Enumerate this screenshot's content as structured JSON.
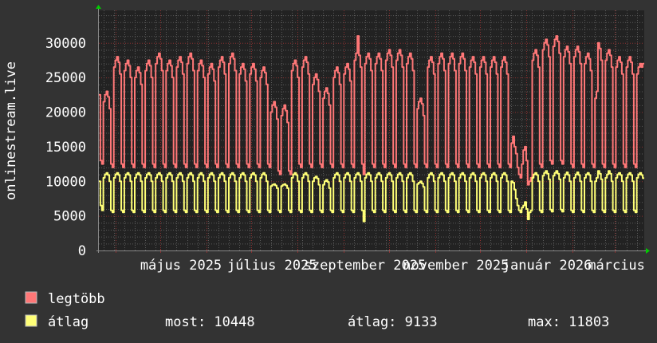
{
  "chart_data": {
    "type": "line",
    "ylabel": "onlinestream.live",
    "ylim": [
      0,
      34700
    ],
    "xlim": [
      "2025-03-21",
      "2026-03-21"
    ],
    "grid": true,
    "y_ticks": [
      "0",
      "5000",
      "10000",
      "15000",
      "20000",
      "25000",
      "30000"
    ],
    "y_tick_values": [
      0,
      5000,
      10000,
      15000,
      20000,
      25000,
      30000
    ],
    "x_tick_labels": [
      {
        "label": "május 2025",
        "date": "2025-05-15"
      },
      {
        "label": "július 2025",
        "date": "2025-07-15"
      },
      {
        "label": "szeptember 2025",
        "date": "2025-09-15"
      },
      {
        "label": "november 2025",
        "date": "2025-11-15"
      },
      {
        "label": "január 2026",
        "date": "2026-01-15"
      },
      {
        "label": "március",
        "date": "2026-03-15"
      }
    ],
    "series": [
      {
        "name": "legtöbb",
        "color": "#ff7777",
        "values": [
          22500,
          13000,
          12500,
          21500,
          22500,
          23000,
          22200,
          20500,
          12500,
          12000,
          26500,
          27500,
          28000,
          27200,
          25500,
          12500,
          12000,
          26000,
          27000,
          27500,
          26700,
          25000,
          12500,
          12000,
          25000,
          26000,
          26500,
          25700,
          24000,
          12500,
          12000,
          26000,
          27000,
          27500,
          26700,
          25000,
          12500,
          12000,
          27000,
          28000,
          28500,
          27700,
          26000,
          12500,
          12000,
          26000,
          27000,
          27500,
          26700,
          25000,
          12500,
          12000,
          26500,
          27500,
          28000,
          27200,
          25500,
          12500,
          12000,
          27000,
          28000,
          28500,
          27700,
          26000,
          12500,
          12000,
          26000,
          27000,
          27500,
          26700,
          25000,
          12500,
          12000,
          25500,
          26500,
          27000,
          26200,
          24500,
          12500,
          12000,
          26500,
          27500,
          28000,
          27200,
          25500,
          12500,
          12000,
          27000,
          28000,
          28500,
          27700,
          26000,
          12500,
          12000,
          25500,
          26500,
          27000,
          26200,
          24500,
          12500,
          12000,
          25500,
          26500,
          27000,
          26200,
          24500,
          12500,
          12000,
          25000,
          26000,
          26500,
          25700,
          24000,
          12500,
          12000,
          20000,
          21000,
          21500,
          20700,
          19000,
          11500,
          11000,
          19500,
          20500,
          21000,
          20200,
          18500,
          11500,
          11000,
          26000,
          27000,
          27500,
          26700,
          25000,
          12500,
          12000,
          26500,
          27500,
          28000,
          27200,
          25500,
          12500,
          12000,
          24000,
          25000,
          25500,
          24700,
          23000,
          12500,
          12000,
          22000,
          23000,
          23500,
          22700,
          21000,
          12500,
          12000,
          25000,
          26000,
          26500,
          25700,
          24000,
          12500,
          12000,
          25500,
          26500,
          27000,
          26200,
          24500,
          12500,
          12000,
          27500,
          28500,
          31000,
          28200,
          26500,
          12500,
          11000,
          27000,
          28000,
          28500,
          27700,
          26000,
          12500,
          12000,
          27000,
          28000,
          28500,
          27700,
          26000,
          12500,
          12000,
          27500,
          28500,
          29000,
          28200,
          26500,
          12500,
          12000,
          27500,
          28500,
          29000,
          28200,
          26500,
          12500,
          12000,
          27000,
          28000,
          28500,
          27700,
          26000,
          12500,
          12000,
          20500,
          21500,
          22000,
          21200,
          19500,
          12500,
          12000,
          26500,
          27500,
          28000,
          27200,
          25500,
          12500,
          12000,
          27000,
          28000,
          28500,
          27700,
          26000,
          12500,
          12000,
          27000,
          28000,
          28500,
          27700,
          26000,
          12500,
          12000,
          27000,
          28000,
          28500,
          27700,
          26000,
          12500,
          12000,
          26500,
          27500,
          28000,
          27200,
          25500,
          12500,
          12000,
          26500,
          27500,
          28000,
          27200,
          25500,
          12500,
          12000,
          26500,
          27500,
          28000,
          27200,
          25500,
          12500,
          12000,
          26500,
          27500,
          28000,
          27200,
          25500,
          12500,
          12000,
          15500,
          16500,
          15000,
          14000,
          12000,
          11000,
          10500,
          12500,
          14500,
          15000,
          13000,
          9500,
          10000,
          10500,
          27500,
          28500,
          29000,
          28200,
          26500,
          12500,
          12000,
          29000,
          30000,
          30500,
          29700,
          28000,
          13000,
          12500,
          29500,
          30500,
          31000,
          30200,
          28500,
          13000,
          12500,
          28000,
          29000,
          29500,
          28700,
          27000,
          12500,
          12000,
          28000,
          29000,
          29500,
          28700,
          27000,
          12500,
          12000,
          27000,
          28000,
          28500,
          27700,
          26000,
          12500,
          12000,
          22000,
          23000,
          30000,
          29200,
          27500,
          12500,
          12000,
          27500,
          28500,
          29000,
          28200,
          26500,
          12500,
          12000,
          26500,
          27500,
          28000,
          27200,
          25500,
          12500,
          12000,
          26500,
          27500,
          28000,
          27200,
          25500,
          12500,
          12000,
          25500,
          26500,
          27000,
          26500,
          27000
        ]
      },
      {
        "name": "átlag",
        "color": "#ffff77",
        "values": [
          10000,
          6500,
          5800,
          10500,
          11000,
          11200,
          10900,
          10000,
          5800,
          5500,
          10500,
          11000,
          11200,
          10900,
          10000,
          5800,
          5500,
          10500,
          11000,
          11200,
          10900,
          10000,
          5800,
          5500,
          10500,
          11000,
          11200,
          10900,
          10000,
          5800,
          5500,
          10500,
          11000,
          11200,
          10900,
          10000,
          5800,
          5500,
          10500,
          11000,
          11200,
          10900,
          10000,
          5800,
          5500,
          10500,
          11000,
          11200,
          10900,
          10000,
          5800,
          5500,
          10500,
          11000,
          11200,
          10900,
          10000,
          5800,
          5500,
          10500,
          11000,
          11200,
          10900,
          10000,
          5800,
          5500,
          10500,
          11000,
          11200,
          10900,
          10000,
          5800,
          5500,
          10500,
          11000,
          11200,
          10900,
          10000,
          5800,
          5500,
          10500,
          11000,
          11200,
          10900,
          10000,
          5800,
          5500,
          10500,
          11000,
          11200,
          10900,
          10000,
          5800,
          5500,
          10500,
          11000,
          11200,
          10900,
          10000,
          5800,
          5500,
          10500,
          11000,
          11200,
          10900,
          10000,
          5800,
          5500,
          10500,
          11000,
          11200,
          10900,
          10000,
          5800,
          5500,
          9300,
          9500,
          9600,
          9400,
          9000,
          5800,
          5500,
          9300,
          9500,
          9600,
          9400,
          9000,
          5800,
          5500,
          10500,
          11000,
          11200,
          10900,
          10000,
          5800,
          5500,
          10500,
          11000,
          11200,
          10900,
          10000,
          5800,
          5500,
          10000,
          10500,
          10700,
          10400,
          9500,
          5800,
          5500,
          9500,
          10000,
          10200,
          9900,
          9000,
          5800,
          5500,
          10500,
          11000,
          11200,
          10900,
          10000,
          5800,
          5500,
          10500,
          11000,
          11200,
          10900,
          10000,
          5800,
          5500,
          10500,
          11000,
          11200,
          10900,
          10000,
          5800,
          4200,
          10500,
          11000,
          11200,
          10900,
          10000,
          5800,
          5500,
          10500,
          11000,
          11200,
          10900,
          10000,
          5800,
          5500,
          10500,
          11000,
          11200,
          10900,
          10000,
          5800,
          5500,
          10500,
          11000,
          11200,
          10900,
          10000,
          5800,
          5500,
          10500,
          11000,
          11200,
          10900,
          10000,
          5800,
          5500,
          9600,
          9800,
          10000,
          9700,
          9200,
          5800,
          5500,
          10500,
          11000,
          11200,
          10900,
          10000,
          5800,
          5500,
          10500,
          11000,
          11200,
          10900,
          10000,
          5800,
          5500,
          10500,
          11000,
          11200,
          10900,
          10000,
          5800,
          5500,
          10500,
          11000,
          11200,
          10900,
          10000,
          5800,
          5500,
          10500,
          11000,
          11200,
          10900,
          10000,
          5800,
          5500,
          10500,
          11000,
          11200,
          10900,
          10000,
          5800,
          5500,
          10500,
          11000,
          11200,
          10900,
          10000,
          5800,
          5500,
          10500,
          11000,
          11200,
          10900,
          10000,
          5800,
          5500,
          10000,
          9800,
          8800,
          7500,
          6500,
          5800,
          5500,
          6200,
          6500,
          7000,
          6000,
          4500,
          5500,
          5800,
          10500,
          11000,
          11200,
          10900,
          10000,
          5800,
          5500,
          10800,
          11200,
          11500,
          11100,
          10300,
          5900,
          5600,
          10800,
          11200,
          11500,
          11100,
          10300,
          5900,
          5600,
          10500,
          11000,
          11300,
          10900,
          10000,
          5800,
          5500,
          10500,
          11000,
          11300,
          10900,
          10000,
          5800,
          5500,
          10500,
          11000,
          11200,
          10900,
          10000,
          5800,
          5500,
          10000,
          10500,
          11500,
          11100,
          10300,
          5800,
          5500,
          10500,
          11000,
          11500,
          11100,
          10000,
          5800,
          5500,
          10500,
          11000,
          11200,
          10900,
          10000,
          5800,
          5500,
          10500,
          11000,
          11200,
          10900,
          10000,
          5800,
          5500,
          10500,
          11000,
          11200,
          10900,
          10448
        ]
      }
    ]
  },
  "legend": {
    "items": [
      {
        "label": "legtöbb",
        "color": "#ff7777"
      },
      {
        "label": "átlag",
        "color": "#ffff77"
      }
    ],
    "stats": {
      "most": "most: 10448",
      "atlag": "átlag: 9133",
      "max": "max: 11803"
    }
  },
  "colors": {
    "background": "#333333",
    "plot": "#222222",
    "grid_minor": "#5a5a5a",
    "grid_major": "#8a3030",
    "axis_arrow": "#00cc00"
  }
}
